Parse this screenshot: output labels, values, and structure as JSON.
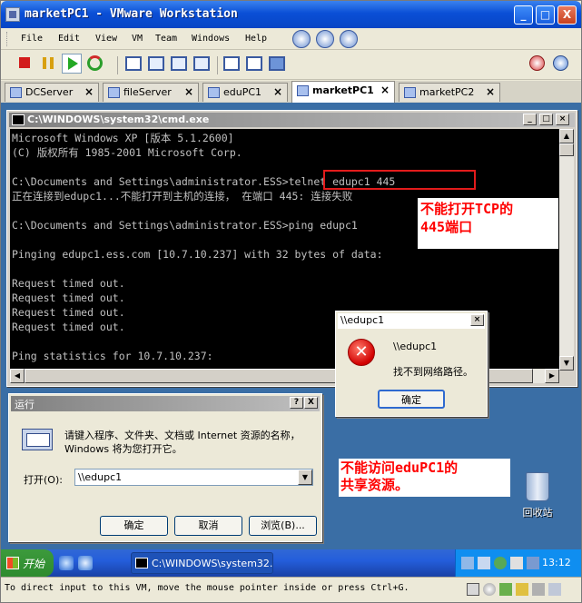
{
  "window": {
    "title": "marketPC1 - VMware Workstation",
    "controls": {
      "minimize": "_",
      "maximize": "□",
      "close": "X"
    }
  },
  "menu": [
    "File",
    "Edit",
    "View",
    "VM",
    "Team",
    "Windows",
    "Help"
  ],
  "tabs": [
    {
      "label": "DCServer",
      "active": false
    },
    {
      "label": "fileServer",
      "active": false
    },
    {
      "label": "eduPC1",
      "active": false
    },
    {
      "label": "marketPC1",
      "active": true
    },
    {
      "label": "marketPC2",
      "active": false
    }
  ],
  "cmd": {
    "title": "C:\\WINDOWS\\system32\\cmd.exe",
    "lines": [
      "Microsoft Windows XP [版本 5.1.2600]",
      "(C) 版权所有 1985-2001 Microsoft Corp.",
      "",
      "C:\\Documents and Settings\\administrator.ESS>telnet edupc1 445",
      "正在连接到edupc1...不能打开到主机的连接， 在端口 445: 连接失败",
      "",
      "C:\\Documents and Settings\\administrator.ESS>ping edupc1",
      "",
      "Pinging edupc1.ess.com [10.7.10.237] with 32 bytes of data:",
      "",
      "Request timed out.",
      "Request timed out.",
      "Request timed out.",
      "Request timed out.",
      "",
      "Ping statistics for 10.7.10.237:"
    ]
  },
  "annotations": {
    "telnet_note": [
      "不能打开TCP的",
      "445端口"
    ],
    "share_note": [
      "不能访问eduPC1的",
      "共享资源。"
    ]
  },
  "error_dialog": {
    "title": "\\\\edupc1",
    "path": "\\\\edupc1",
    "message": "找不到网络路径。",
    "ok_label": "确定"
  },
  "run_dialog": {
    "title": "运行",
    "description": "请键入程序、文件夹、文档或 Internet 资源的名称，Windows 将为您打开它。",
    "open_label": "打开(O):",
    "open_value": "\\\\edupc1",
    "ok_label": "确定",
    "cancel_label": "取消",
    "browse_label": "浏览(B)...",
    "help_label": "?",
    "close_label": "X"
  },
  "desktop": {
    "recycle_bin_label": "回收站"
  },
  "taskbar": {
    "start_label": "开始",
    "task_label": "C:\\WINDOWS\\system32...",
    "clock": "13:12"
  },
  "statusbar": {
    "text": "To direct input to this VM, move the mouse pointer inside or press Ctrl+G."
  }
}
